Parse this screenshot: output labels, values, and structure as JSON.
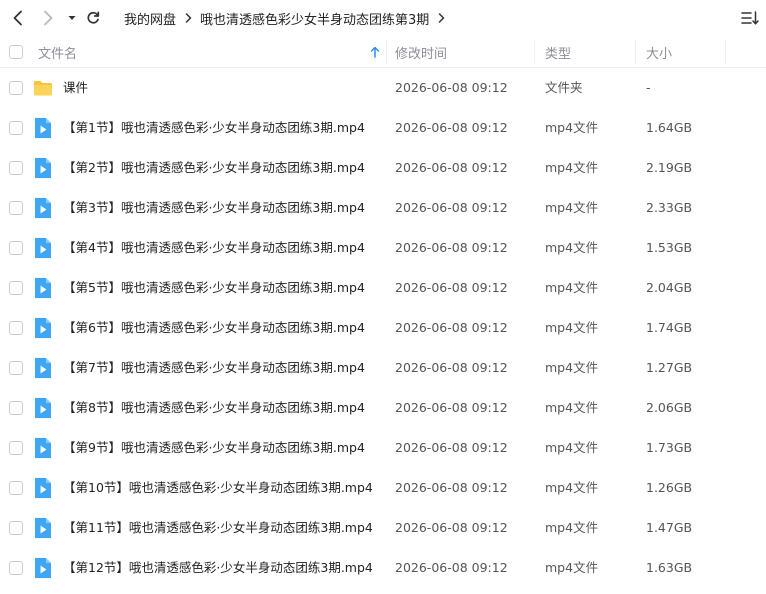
{
  "breadcrumb": {
    "root": "我的网盘",
    "current": "哦也清透感色彩少女半身动态团练第3期"
  },
  "columns": {
    "name": "文件名",
    "modified": "修改时间",
    "type": "类型",
    "size": "大小"
  },
  "colors": {
    "accent": "#2f8cf0",
    "folder": "#f8c440",
    "video": "#3ea6f5"
  },
  "icons": {
    "back": "back-arrow-icon",
    "forward": "forward-arrow-icon",
    "history": "chevron-down-icon",
    "refresh": "refresh-icon",
    "sort": "sort-ascending-icon",
    "list_mode": "list-mode-icon",
    "folder": "folder-icon",
    "video": "video-file-icon"
  },
  "files": [
    {
      "name": "课件",
      "modified": "2026-06-08 09:12",
      "type": "文件夹",
      "size": "-",
      "kind": "folder"
    },
    {
      "name": "【第1节】哦也清透感色彩·少女半身动态团练3期.mp4",
      "modified": "2026-06-08 09:12",
      "type": "mp4文件",
      "size": "1.64GB",
      "kind": "video"
    },
    {
      "name": "【第2节】哦也清透感色彩·少女半身动态团练3期.mp4",
      "modified": "2026-06-08 09:12",
      "type": "mp4文件",
      "size": "2.19GB",
      "kind": "video"
    },
    {
      "name": "【第3节】哦也清透感色彩·少女半身动态团练3期.mp4",
      "modified": "2026-06-08 09:12",
      "type": "mp4文件",
      "size": "2.33GB",
      "kind": "video"
    },
    {
      "name": "【第4节】哦也清透感色彩·少女半身动态团练3期.mp4",
      "modified": "2026-06-08 09:12",
      "type": "mp4文件",
      "size": "1.53GB",
      "kind": "video"
    },
    {
      "name": "【第5节】哦也清透感色彩·少女半身动态团练3期.mp4",
      "modified": "2026-06-08 09:12",
      "type": "mp4文件",
      "size": "2.04GB",
      "kind": "video"
    },
    {
      "name": "【第6节】哦也清透感色彩·少女半身动态团练3期.mp4",
      "modified": "2026-06-08 09:12",
      "type": "mp4文件",
      "size": "1.74GB",
      "kind": "video"
    },
    {
      "name": "【第7节】哦也清透感色彩·少女半身动态团练3期.mp4",
      "modified": "2026-06-08 09:12",
      "type": "mp4文件",
      "size": "1.27GB",
      "kind": "video"
    },
    {
      "name": "【第8节】哦也清透感色彩·少女半身动态团练3期.mp4",
      "modified": "2026-06-08 09:12",
      "type": "mp4文件",
      "size": "2.06GB",
      "kind": "video"
    },
    {
      "name": "【第9节】哦也清透感色彩·少女半身动态团练3期.mp4",
      "modified": "2026-06-08 09:12",
      "type": "mp4文件",
      "size": "1.73GB",
      "kind": "video"
    },
    {
      "name": "【第10节】哦也清透感色彩·少女半身动态团练3期.mp4",
      "modified": "2026-06-08 09:12",
      "type": "mp4文件",
      "size": "1.26GB",
      "kind": "video"
    },
    {
      "name": "【第11节】哦也清透感色彩·少女半身动态团练3期.mp4",
      "modified": "2026-06-08 09:12",
      "type": "mp4文件",
      "size": "1.47GB",
      "kind": "video"
    },
    {
      "name": "【第12节】哦也清透感色彩·少女半身动态团练3期.mp4",
      "modified": "2026-06-08 09:12",
      "type": "mp4文件",
      "size": "1.63GB",
      "kind": "video"
    }
  ]
}
